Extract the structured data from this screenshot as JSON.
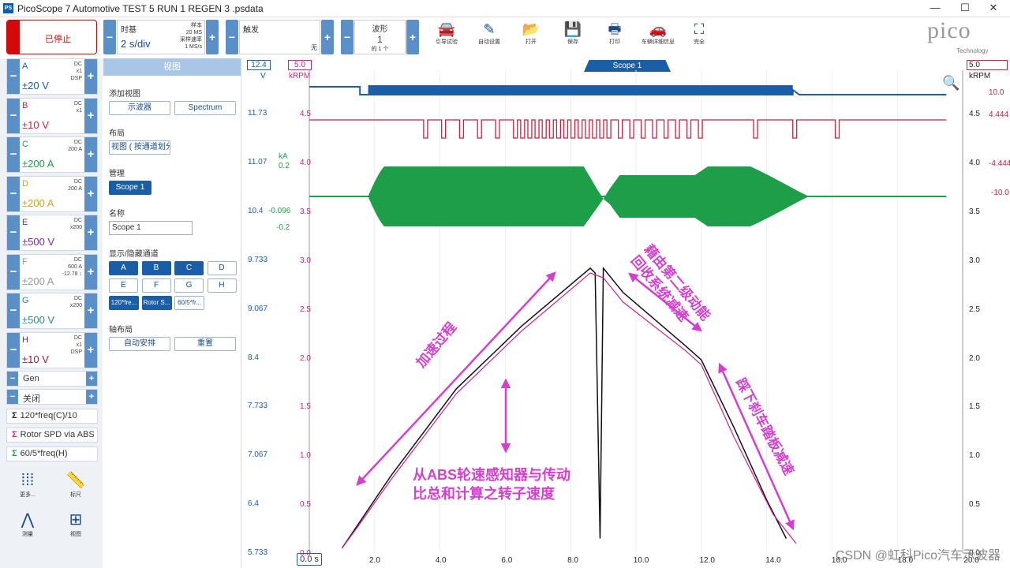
{
  "window": {
    "title": "PicoScope 7 Automotive TEST 5 RUN 1 REGEN 3 .psdata",
    "controls": [
      "—",
      "☐",
      "✕"
    ]
  },
  "toolbar": {
    "stop_label": "已停止",
    "timebase": {
      "caption": "时基",
      "value": "2 s/div",
      "samples_label": "样本",
      "samples": "20 MS",
      "rate_label": "采样速率",
      "rate": "1 MS/s"
    },
    "trigger": {
      "caption": "触发",
      "mode": "无"
    },
    "waveform": {
      "caption": "波形",
      "value": "1",
      "count": "的 1 个"
    },
    "icons": [
      {
        "label": "引导试验",
        "icon": "car-icon",
        "glyph": "🚘"
      },
      {
        "label": "自动设置",
        "icon": "wand-icon",
        "glyph": "✎"
      },
      {
        "label": "打开",
        "icon": "folder-icon",
        "glyph": "📂"
      },
      {
        "label": "保存",
        "icon": "save-icon",
        "glyph": "💾"
      },
      {
        "label": "打印",
        "icon": "print-icon",
        "glyph": "🖶"
      },
      {
        "label": "车辆详细信息",
        "icon": "vehicle-info-icon",
        "glyph": "🚗"
      },
      {
        "label": "完全",
        "icon": "fullscreen-icon",
        "glyph": "⛶"
      }
    ],
    "logo": "pico",
    "logo_sub": "Technology"
  },
  "channels": [
    {
      "name": "A",
      "range": "±20 V",
      "coupling": "DC\nx1\nDSP",
      "color": "#1a5ea8"
    },
    {
      "name": "B",
      "range": "±10 V",
      "coupling": "DC\nx1",
      "color": "#d21f3c"
    },
    {
      "name": "C",
      "range": "±200 A",
      "coupling": "DC\n200 A",
      "color": "#1f9e4a"
    },
    {
      "name": "D",
      "range": "±200 A",
      "coupling": "DC\n200 A",
      "color": "#d4a20c"
    },
    {
      "name": "E",
      "range": "±500 V",
      "coupling": "DC\nx200",
      "color": "#7a2a9a"
    },
    {
      "name": "F",
      "range": "±200 A",
      "coupling": "DC\n600 A\n-12.78 ↓",
      "color": "#9a9a9a"
    },
    {
      "name": "G",
      "range": "±500 V",
      "coupling": "DC\nx200",
      "color": "#2a8a8a"
    },
    {
      "name": "H",
      "range": "±10 V",
      "coupling": "DC\nx1\nDSP",
      "color": "#9a1a4a"
    }
  ],
  "gen": {
    "label": "Gen",
    "value": "关闭"
  },
  "math": [
    {
      "label": "120*freq(C)/10",
      "color": "#222"
    },
    {
      "label": "Rotor SPD via ABS",
      "color": "#d21f8a"
    },
    {
      "label": "60/5*freq(H)",
      "color": "#1f9e4a"
    }
  ],
  "bottom_icons": [
    {
      "label": "更多...",
      "icon": "grid-dots-icon",
      "glyph": "⁞⁞⁞"
    },
    {
      "label": "标尺",
      "icon": "ruler-icon",
      "glyph": "📏"
    },
    {
      "label": "测量",
      "icon": "compass-icon",
      "glyph": "⋀"
    },
    {
      "label": "视图",
      "icon": "view-grid-icon",
      "glyph": "⊞"
    }
  ],
  "view_panel": {
    "header": "视图",
    "add_view": "添加视图",
    "btn_scope": "示波器",
    "btn_spectrum": "Spectrum",
    "layout": "布局",
    "layout_value": "视图 ( 按通道划分",
    "manage": "管理",
    "scope_btn": "Scope 1",
    "name": "名称",
    "name_value": "Scope 1",
    "show_hide": "显示/隐藏通道",
    "ch_buttons": [
      "A",
      "B",
      "C",
      "D",
      "E",
      "F",
      "G",
      "H"
    ],
    "ch_on": [
      true,
      true,
      true,
      false,
      false,
      false,
      false,
      false
    ],
    "math_buttons": [
      "120*fre...",
      "Rotor S...",
      "60/5*fr..."
    ],
    "math_on": [
      true,
      true,
      false
    ],
    "axis_layout": "轴布局",
    "auto_arrange": "自动安排",
    "reset": "重置"
  },
  "scope": {
    "tab": "Scope 1",
    "top_left_box": "12.4",
    "top_left_unit": "V",
    "top_left_box2": "5.0",
    "top_left_unit2": "kRPM",
    "top_right_box": "5.0",
    "top_right_unit": "kRPM",
    "left_axis_a": [
      "11.73",
      "11.07",
      "10.4",
      "9.733",
      "9.067",
      "8.4",
      "7.733",
      "7.067",
      "6.4",
      "5.733"
    ],
    "left_axis_c": {
      "unit": "kA",
      "top": "0.2",
      "mid": "-0.096",
      "bot": "-0.2"
    },
    "mid_axis": [
      "4.5",
      "4.0",
      "3.5",
      "3.0",
      "2.5",
      "2.0",
      "1.5",
      "1.0",
      "0.5",
      "0.0"
    ],
    "right_axis_b": [
      "10.0",
      "4.444",
      "-4.444",
      "-10.0"
    ],
    "right_axis": [
      "4.5",
      "4.0",
      "3.5",
      "3.0",
      "2.5",
      "2.0",
      "1.5",
      "1.0",
      "0.5",
      "0.0"
    ],
    "x_axis": [
      "0.0 s",
      "2.0",
      "4.0",
      "6.0",
      "8.0",
      "10.0",
      "12.0",
      "14.0",
      "16.0",
      "18.0",
      "20.0"
    ]
  },
  "annotations": {
    "accel": "加速过程",
    "regen": "藉由第二级动能\n回收系统减速",
    "brake": "踩下刹车踏板减速",
    "calc": "从ABS轮速感知器与传动\n比总和计算之转子速度"
  },
  "watermark": "CSDN @虹科Pico汽车示波器",
  "colors": {
    "blue": "#1a5ea8",
    "red": "#d21f3c",
    "green": "#1f9e4a",
    "magenta": "#d43fd0",
    "black": "#111"
  }
}
